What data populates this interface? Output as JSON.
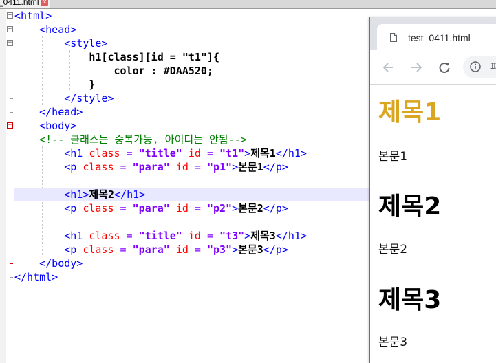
{
  "editor_tab": {
    "filename": "_0411.html",
    "close_label": "x"
  },
  "code_lines": [
    {
      "parts": [
        [
          "tag",
          "<html>"
        ]
      ]
    },
    {
      "parts": [
        [
          "sp",
          "    "
        ],
        [
          "tag",
          "<head>"
        ]
      ]
    },
    {
      "parts": [
        [
          "sp",
          "        "
        ],
        [
          "tag",
          "<style>"
        ]
      ]
    },
    {
      "parts": [
        [
          "sp",
          "            "
        ],
        [
          "css-sel",
          "h1[class][id = \"t1\"]{"
        ]
      ]
    },
    {
      "parts": [
        [
          "sp",
          "                "
        ],
        [
          "css-sel",
          "color : #DAA520;"
        ]
      ]
    },
    {
      "parts": [
        [
          "sp",
          "            "
        ],
        [
          "css-sel",
          "}"
        ]
      ]
    },
    {
      "parts": [
        [
          "sp",
          "        "
        ],
        [
          "tag",
          "</style>"
        ]
      ]
    },
    {
      "parts": [
        [
          "sp",
          "    "
        ],
        [
          "tag",
          "</head>"
        ]
      ]
    },
    {
      "parts": [
        [
          "sp",
          "    "
        ],
        [
          "tag",
          "<body>"
        ]
      ]
    },
    {
      "parts": [
        [
          "sp",
          "    "
        ],
        [
          "cmt",
          "<!-- 클래스는 중복가능, 아이디는 안됨-->"
        ]
      ]
    },
    {
      "parts": [
        [
          "sp",
          "        "
        ],
        [
          "tag",
          "<h1 "
        ],
        [
          "attr",
          "class"
        ],
        [
          "op",
          " = "
        ],
        [
          "str",
          "\"title\""
        ],
        [
          "attr",
          " id"
        ],
        [
          "op",
          " = "
        ],
        [
          "str",
          "\"t1\""
        ],
        [
          "tag",
          ">"
        ],
        [
          "txt",
          "제목1"
        ],
        [
          "tag",
          "</h1>"
        ]
      ]
    },
    {
      "parts": [
        [
          "sp",
          "        "
        ],
        [
          "tag",
          "<p "
        ],
        [
          "attr",
          "class"
        ],
        [
          "op",
          " = "
        ],
        [
          "str",
          "\"para\""
        ],
        [
          "attr",
          " id"
        ],
        [
          "op",
          " = "
        ],
        [
          "str",
          "\"p1\""
        ],
        [
          "tag",
          ">"
        ],
        [
          "txt",
          "본문1"
        ],
        [
          "tag",
          "</p>"
        ]
      ]
    },
    {
      "parts": []
    },
    {
      "parts": [
        [
          "sp",
          "        "
        ],
        [
          "tag",
          "<h1>"
        ],
        [
          "txt",
          "제목2"
        ],
        [
          "tag",
          "</h1>"
        ]
      ],
      "current": true
    },
    {
      "parts": [
        [
          "sp",
          "        "
        ],
        [
          "tag",
          "<p "
        ],
        [
          "attr",
          "class"
        ],
        [
          "op",
          " = "
        ],
        [
          "str",
          "\"para\""
        ],
        [
          "attr",
          " id"
        ],
        [
          "op",
          " = "
        ],
        [
          "str",
          "\"p2\""
        ],
        [
          "tag",
          ">"
        ],
        [
          "txt",
          "본문2"
        ],
        [
          "tag",
          "</p>"
        ]
      ]
    },
    {
      "parts": []
    },
    {
      "parts": [
        [
          "sp",
          "        "
        ],
        [
          "tag",
          "<h1 "
        ],
        [
          "attr",
          "class"
        ],
        [
          "op",
          " = "
        ],
        [
          "str",
          "\"title\""
        ],
        [
          "attr",
          " id"
        ],
        [
          "op",
          " = "
        ],
        [
          "str",
          "\"t3\""
        ],
        [
          "tag",
          ">"
        ],
        [
          "txt",
          "제목3"
        ],
        [
          "tag",
          "</h1>"
        ]
      ]
    },
    {
      "parts": [
        [
          "sp",
          "        "
        ],
        [
          "tag",
          "<p "
        ],
        [
          "attr",
          "class"
        ],
        [
          "op",
          " = "
        ],
        [
          "str",
          "\"para\""
        ],
        [
          "attr",
          " id"
        ],
        [
          "op",
          " = "
        ],
        [
          "str",
          "\"p3\""
        ],
        [
          "tag",
          ">"
        ],
        [
          "txt",
          "본문3"
        ],
        [
          "tag",
          "</p>"
        ]
      ]
    },
    {
      "parts": [
        [
          "sp",
          "    "
        ],
        [
          "tag",
          "</body>"
        ]
      ]
    },
    {
      "parts": [
        [
          "tag",
          "</html>"
        ]
      ]
    }
  ],
  "browser": {
    "tab_title": "test_0411.html",
    "address_partial": "파",
    "icons": {
      "doc": "document-icon",
      "back": "back-arrow-icon",
      "forward": "forward-arrow-icon",
      "reload": "reload-icon",
      "info": "info-icon"
    },
    "content": [
      {
        "kind": "h1",
        "text": "제목1",
        "color": "#DAA520"
      },
      {
        "kind": "p",
        "text": "본문1"
      },
      {
        "kind": "h1",
        "text": "제목2",
        "color": "#000000"
      },
      {
        "kind": "p",
        "text": "본문2"
      },
      {
        "kind": "h1",
        "text": "제목3",
        "color": "#000000"
      },
      {
        "kind": "p",
        "text": "본문3"
      }
    ]
  },
  "colors": {
    "tag": "#0000FF",
    "attr": "#FF0000",
    "string": "#8000FF",
    "comment": "#008000",
    "current_line": "#E8E8FF",
    "h1_t1": "#DAA520"
  }
}
